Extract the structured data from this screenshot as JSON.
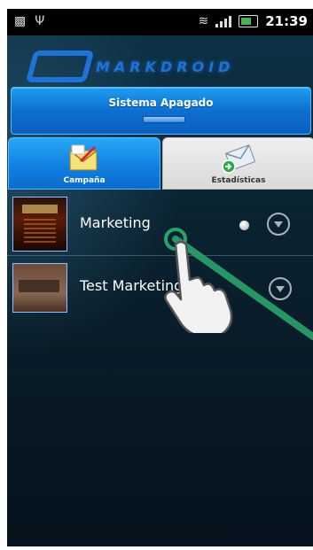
{
  "statusbar": {
    "time": "21:39"
  },
  "header": {
    "logo_text": "MARKDROID"
  },
  "status_panel": {
    "label": "Sistema Apagado"
  },
  "tabs": [
    {
      "label": "Campaña",
      "icon": "envelope-edit-icon",
      "active": true
    },
    {
      "label": "Estadísticas",
      "icon": "envelope-send-icon",
      "active": false
    }
  ],
  "campaigns": [
    {
      "title": "Marketing",
      "indicator": "grey-dot"
    },
    {
      "title": "Test Marketing"
    }
  ],
  "colors": {
    "accent": "#1f8fe8",
    "drag_line": "#2aa36b"
  }
}
